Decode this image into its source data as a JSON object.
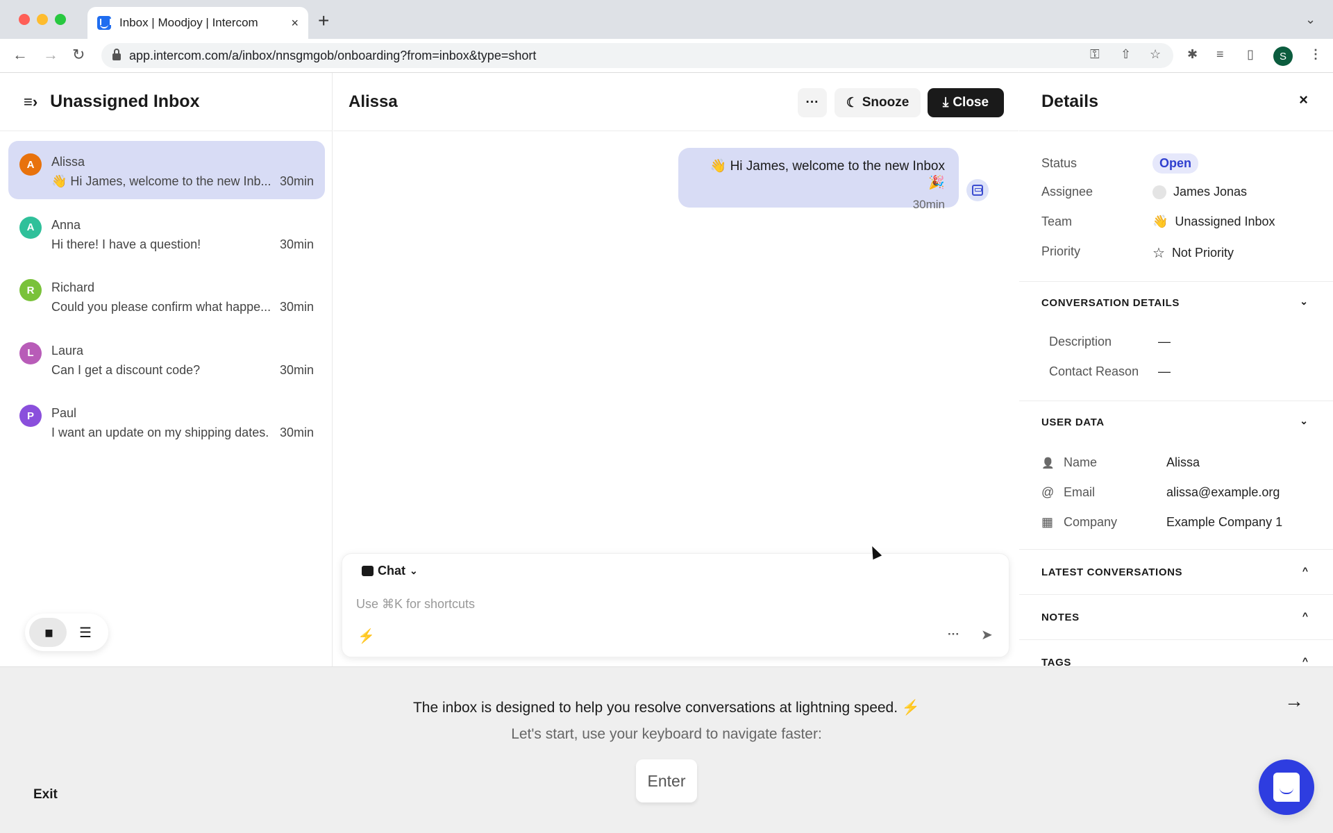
{
  "browser": {
    "tab_title": "Inbox | Moodjoy | Intercom",
    "tab_close": "×",
    "new_tab": "+",
    "tab_list": "⌄",
    "back": "←",
    "forward": "→",
    "reload": "↻",
    "url": "app.intercom.com/a/inbox/nnsgmgob/onboarding?from=inbox&type=short",
    "key_icon": "⚿",
    "share_icon": "⇧",
    "star_icon": "☆",
    "ext_icon": "✱",
    "media_icon": "≡",
    "sidepanel_icon": "▯",
    "profile_initial": "S",
    "menu_icon": "⋮"
  },
  "left": {
    "menu_icon": "≡›",
    "title": "Unassigned Inbox",
    "conversations": [
      {
        "initial": "A",
        "name": "Alissa",
        "preview": "👋 Hi James, welcome to the new Inb...",
        "time": "30min",
        "color": "#e8720c",
        "selected": true
      },
      {
        "initial": "A",
        "name": "Anna",
        "preview": "Hi there! I have a question!",
        "time": "30min",
        "color": "#2fc09a"
      },
      {
        "initial": "R",
        "name": "Richard",
        "preview": "Could you please confirm what happe...",
        "time": "30min",
        "color": "#7ac23a"
      },
      {
        "initial": "L",
        "name": "Laura",
        "preview": "Can I get a discount code?",
        "time": "30min",
        "color": "#b85cb8"
      },
      {
        "initial": "P",
        "name": "Paul",
        "preview": "I want an update on my shipping dates.",
        "time": "30min",
        "color": "#8a4fdc"
      }
    ],
    "view_toggle": {
      "split_icon": "▮▮",
      "list_icon": "☰"
    }
  },
  "main": {
    "title": "Alissa",
    "more_label": "···",
    "snooze_icon": "☾",
    "snooze_label": "Snooze",
    "close_icon": "⤓",
    "close_label": "Close",
    "message": {
      "text": "👋 Hi James, welcome to the new Inbox 🎉",
      "time": "30min"
    },
    "composer": {
      "mode_label": "Chat",
      "mode_chevron": "⌄",
      "placeholder": "Use ⌘K for shortcuts",
      "bolt_icon": "⚡",
      "more": "···",
      "send_icon": "➤"
    }
  },
  "details": {
    "title": "Details",
    "close": "×",
    "status_label": "Status",
    "status_value": "Open",
    "assignee_label": "Assignee",
    "assignee_value": "James Jonas",
    "team_label": "Team",
    "team_icon": "👋",
    "team_value": "Unassigned Inbox",
    "priority_label": "Priority",
    "priority_icon": "☆",
    "priority_value": "Not Priority",
    "conversation_details": {
      "heading": "CONVERSATION DETAILS",
      "chevron": "⌄",
      "fields": [
        {
          "label": "Description",
          "value": "—"
        },
        {
          "label": "Contact Reason",
          "value": "—"
        }
      ]
    },
    "user_data": {
      "heading": "USER DATA",
      "chevron": "⌄",
      "fields": [
        {
          "icon": "👤",
          "label": "Name",
          "value": "Alissa"
        },
        {
          "icon": "@",
          "label": "Email",
          "value": "alissa@example.org"
        },
        {
          "icon": "▦",
          "label": "Company",
          "value": "Example Company 1"
        }
      ]
    },
    "latest_conversations": {
      "heading": "LATEST CONVERSATIONS",
      "chevron": "^"
    },
    "notes": {
      "heading": "NOTES",
      "chevron": "^"
    },
    "tags": {
      "heading": "TAGS",
      "chevron": "^"
    }
  },
  "onboarding": {
    "title": "The inbox is designed to help you resolve conversations at lightning speed. ⚡",
    "subtitle": "Let's start, use your keyboard to navigate faster:",
    "key": "Enter",
    "exit": "Exit",
    "next_icon": "→"
  },
  "colors": {
    "accent": "#2e3de0",
    "selected_bg": "#d8dcf5",
    "status_open": "#2f3fcf"
  }
}
